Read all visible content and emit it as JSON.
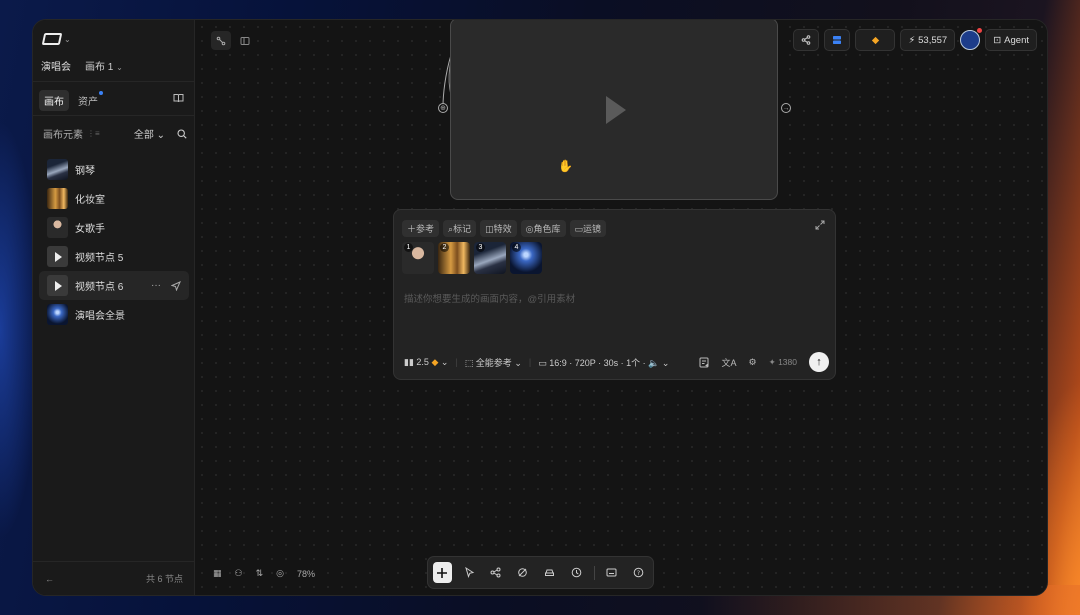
{
  "sidebar": {
    "project_name": "演唱会",
    "canvas_name": "画布 1",
    "tabs": [
      {
        "label": "画布"
      },
      {
        "label": "资产"
      }
    ],
    "section_title": "画布元素",
    "filter_label": "全部",
    "elements": [
      {
        "label": "钢琴",
        "thumb": "piano"
      },
      {
        "label": "化妆室",
        "thumb": "room"
      },
      {
        "label": "女歌手",
        "thumb": "singer"
      },
      {
        "label": "视频节点 5",
        "thumb": "play"
      },
      {
        "label": "视频节点 6",
        "thumb": "play"
      },
      {
        "label": "演唱会全景",
        "thumb": "stage"
      }
    ],
    "node_count": "共 6 节点"
  },
  "topbar": {
    "credits": "53,557",
    "agent_label": "Agent"
  },
  "prompt": {
    "chips": [
      "参考",
      "标记",
      "特效",
      "角色库",
      "运镜"
    ],
    "refs": [
      "1",
      "2",
      "3",
      "4"
    ],
    "placeholder": "描述你想要生成的画面内容，@引用素材",
    "model": "2.5",
    "mode": "全能参考",
    "settings": "16:9 · 720P · 30s · 1个 · ",
    "cost": "1380"
  },
  "bottom": {
    "zoom": "78%"
  },
  "colors": {
    "accent_blue": "#3b82f6",
    "gem": "#f5a524"
  }
}
